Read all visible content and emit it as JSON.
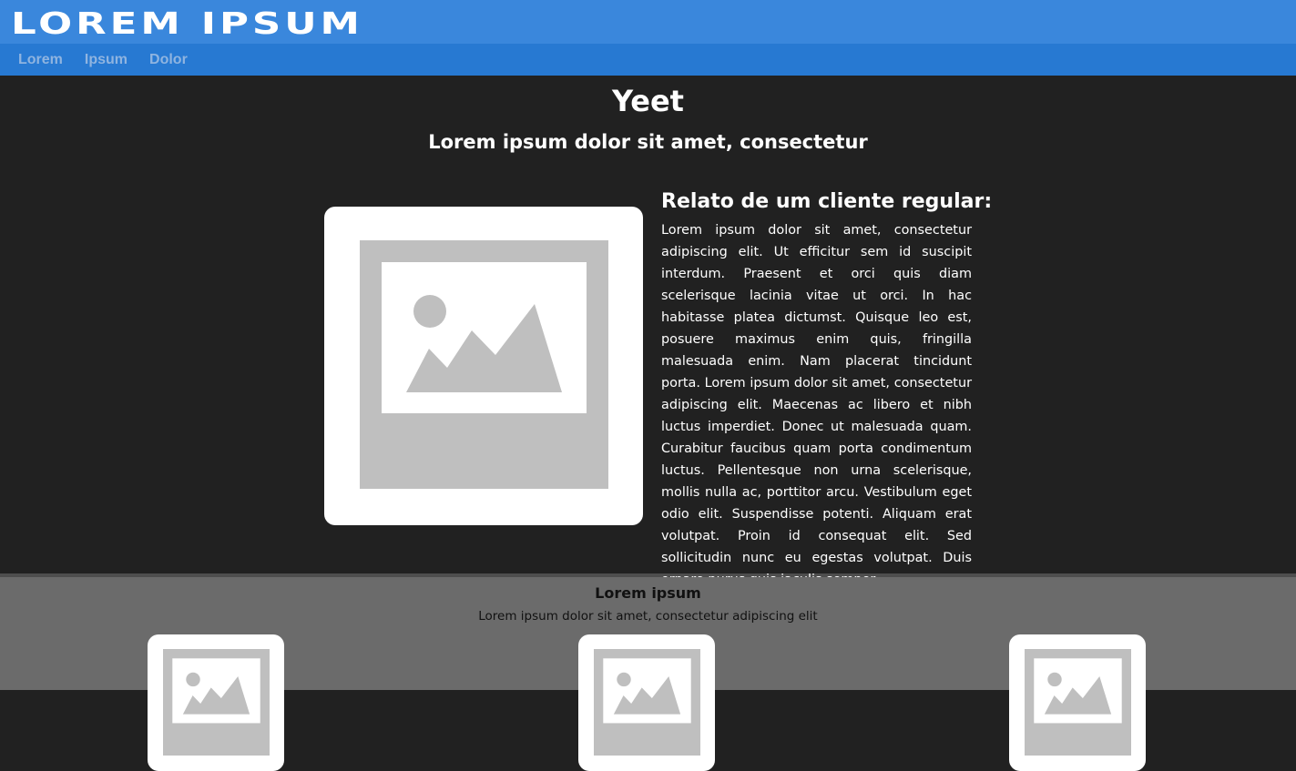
{
  "header": {
    "logo_text": "LOREM IPSUM"
  },
  "nav": {
    "items": [
      "Lorem",
      "Ipsum",
      "Dolor"
    ]
  },
  "hero": {
    "title": "Yeet",
    "subtitle": "Lorem ipsum dolor sit amet, consectetur"
  },
  "testimonial": {
    "heading": "Relato de um cliente regular:",
    "text": "Lorem ipsum dolor sit amet, consectetur adipiscing elit. Ut efficitur sem id suscipit interdum. Praesent et orci quis diam scelerisque lacinia vitae ut orci. In hac habitasse platea dictumst. Quisque leo est, posuere maximus enim quis, fringilla malesuada enim. Nam placerat tincidunt porta. Lorem ipsum dolor sit amet, consectetur adipiscing elit. Maecenas ac libero et nibh luctus imperdiet. Donec ut malesuada quam. Curabitur faucibus quam porta condimentum luctus. Pellentesque non urna scelerisque, mollis nulla ac, porttitor arcu. Vestibulum eget odio elit. Suspendisse potenti. Aliquam erat volutpat. Proin id consequat elit. Sed sollicitudin nunc eu egestas volutpat. Duis ornare purus quis iaculis semper."
  },
  "features": {
    "title": "Lorem ipsum",
    "subtitle": "Lorem ipsum dolor sit amet, consectetur adipiscing elit"
  },
  "colors": {
    "header_bg": "#3a87dc",
    "nav_bg": "#2779d2",
    "nav_text": "#8fb4e0",
    "hero_bg": "#212121",
    "footer_bg": "#6b6b6b",
    "placeholder_gray": "#bfbfbf"
  },
  "icons": [
    "image-placeholder-icon"
  ]
}
